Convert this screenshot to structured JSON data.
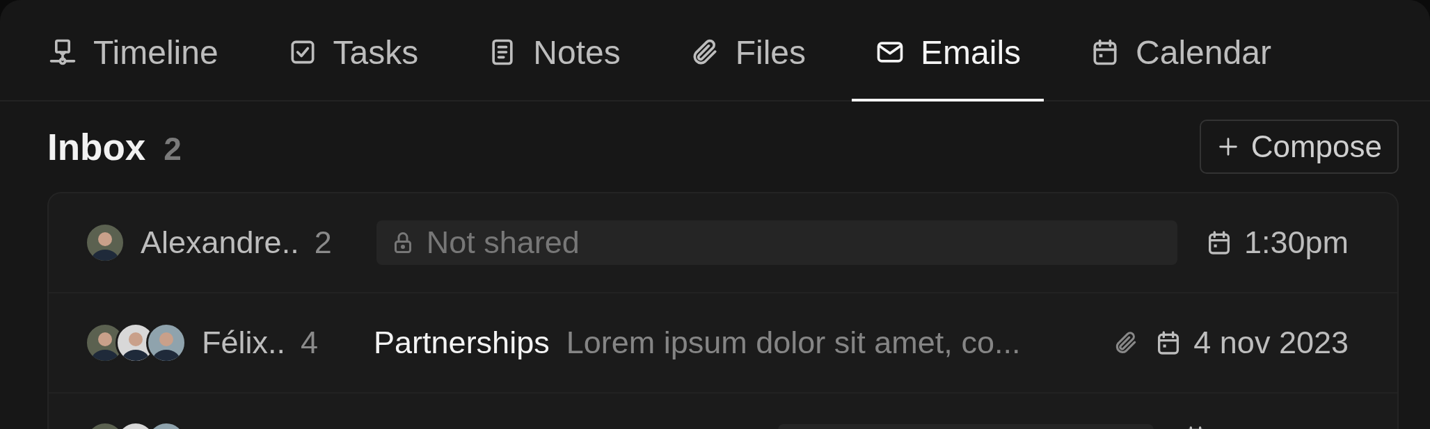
{
  "tabs": [
    {
      "label": "Timeline",
      "selected": false
    },
    {
      "label": "Tasks",
      "selected": false
    },
    {
      "label": "Notes",
      "selected": false
    },
    {
      "label": "Files",
      "selected": false
    },
    {
      "label": "Emails",
      "selected": true
    },
    {
      "label": "Calendar",
      "selected": false
    }
  ],
  "inbox": {
    "title": "Inbox",
    "count": "2",
    "compose_button": "Compose"
  },
  "emails": [
    {
      "kind": "private",
      "avatars": [
        {
          "kind": "photo"
        }
      ],
      "sender": "Alexandre..",
      "count": "2",
      "sharing": "Not shared",
      "time": "1:30pm"
    },
    {
      "kind": "message",
      "avatars": [
        {
          "kind": "photo"
        },
        {
          "kind": "photo"
        },
        {
          "kind": "photo"
        }
      ],
      "sender": "Félix..",
      "count": "4",
      "subject": "Partnerships",
      "preview": "Lorem ipsum dolor sit amet, co...",
      "attachment": true,
      "time": "4 nov 2023"
    },
    {
      "kind": "clipped",
      "avatars": [
        {
          "kind": "photo"
        },
        {
          "kind": "photo"
        },
        {
          "kind": "photo"
        }
      ]
    }
  ]
}
